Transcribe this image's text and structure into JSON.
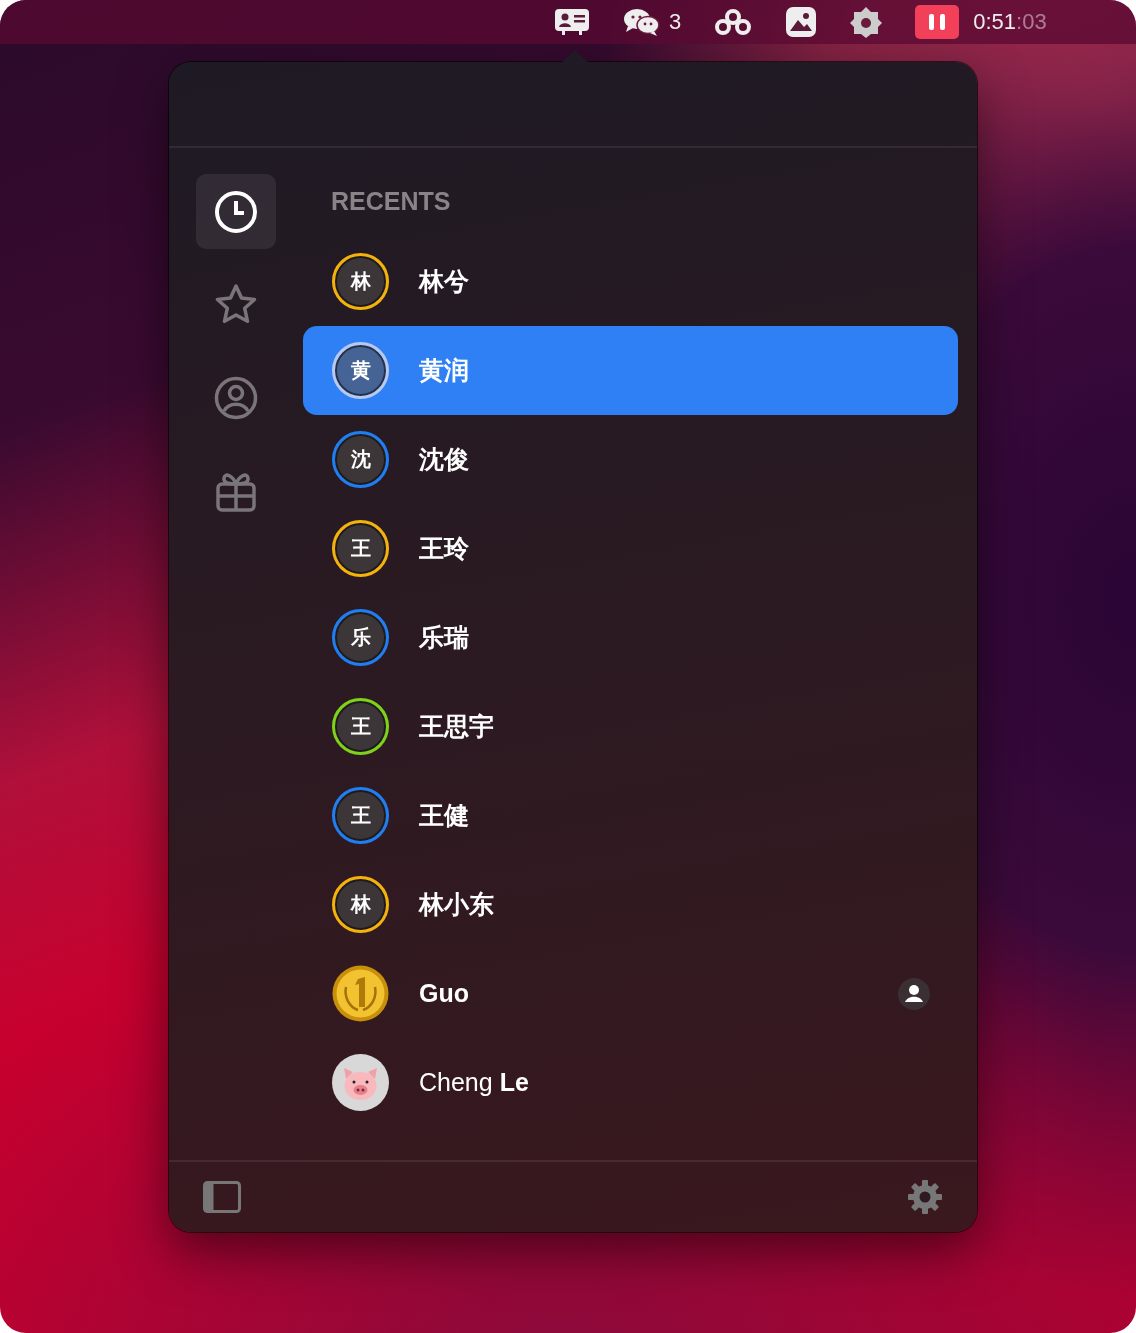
{
  "menu_bar": {
    "items": [
      {
        "kind": "contact-card"
      },
      {
        "kind": "chat",
        "count": "3"
      },
      {
        "kind": "rings"
      },
      {
        "kind": "photo"
      },
      {
        "kind": "flower"
      },
      {
        "kind": "pause"
      }
    ],
    "clock": {
      "time": "0:51",
      "seconds": ":03"
    }
  },
  "popover": {
    "sidebar": {
      "items": [
        {
          "kind": "clock",
          "selected": true
        },
        {
          "kind": "star",
          "selected": false
        },
        {
          "kind": "person",
          "selected": false
        },
        {
          "kind": "gift",
          "selected": false
        }
      ]
    },
    "section_title": "RECENTS",
    "contacts": [
      {
        "name": "林兮",
        "avatar": {
          "kind": "initial",
          "text": "林",
          "color": "#f5b10c"
        },
        "selected": false,
        "contact_icon": false
      },
      {
        "name": "黄润",
        "avatar": {
          "kind": "initial",
          "text": "黄",
          "color": "#b8c8f0"
        },
        "selected": true,
        "contact_icon": false
      },
      {
        "name": "沈俊",
        "avatar": {
          "kind": "initial",
          "text": "沈",
          "color": "#1f7ef2"
        },
        "selected": false,
        "contact_icon": false
      },
      {
        "name": "王玲",
        "avatar": {
          "kind": "initial",
          "text": "王",
          "color": "#f5b10c"
        },
        "selected": false,
        "contact_icon": false
      },
      {
        "name": "乐瑞",
        "avatar": {
          "kind": "initial",
          "text": "乐",
          "color": "#1f7ef2"
        },
        "selected": false,
        "contact_icon": false
      },
      {
        "name": "王思宇",
        "avatar": {
          "kind": "initial",
          "text": "王",
          "color": "#7fd21a"
        },
        "selected": false,
        "contact_icon": false
      },
      {
        "name": "王健",
        "avatar": {
          "kind": "initial",
          "text": "王",
          "color": "#1f7ef2"
        },
        "selected": false,
        "contact_icon": false
      },
      {
        "name": "林小东",
        "avatar": {
          "kind": "initial",
          "text": "林",
          "color": "#f5b10c"
        },
        "selected": false,
        "contact_icon": false
      },
      {
        "name": "Guo",
        "avatar": {
          "kind": "medal"
        },
        "selected": false,
        "contact_icon": true
      },
      {
        "name": "Cheng **Le**",
        "avatar": {
          "kind": "pig"
        },
        "selected": false,
        "contact_icon": false
      }
    ]
  }
}
